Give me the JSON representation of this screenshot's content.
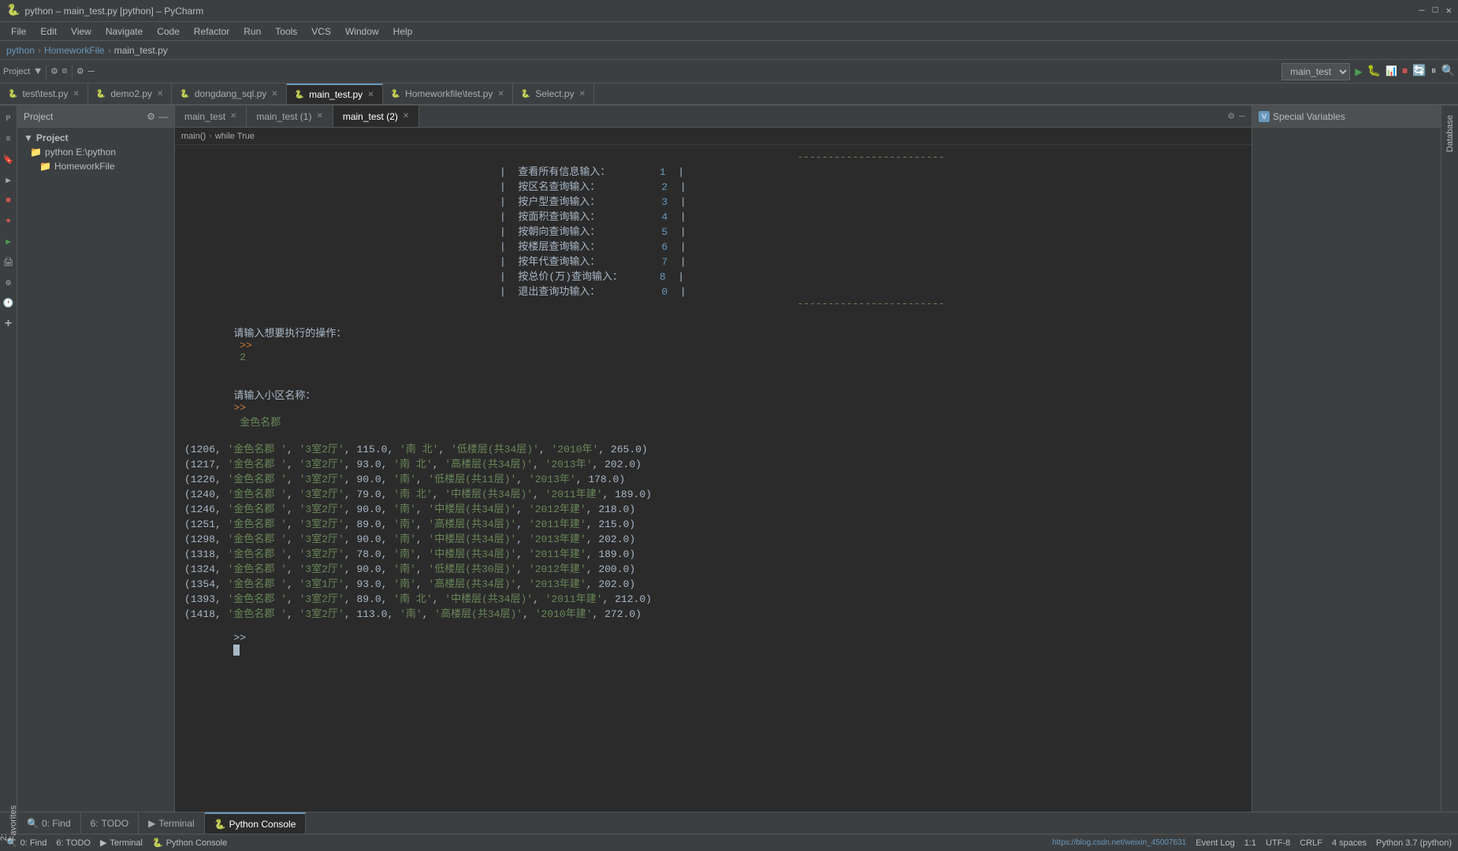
{
  "titlebar": {
    "title": "python – main_test.py [python] – PyCharm",
    "win_min": "—",
    "win_max": "□",
    "win_close": "✕"
  },
  "menubar": {
    "items": [
      "File",
      "Edit",
      "View",
      "Navigate",
      "Code",
      "Refactor",
      "Run",
      "Tools",
      "VCS",
      "Window",
      "Help"
    ]
  },
  "breadcrumb": {
    "parts": [
      "python",
      "HomeworkFile",
      "main_test.py"
    ]
  },
  "run_config": "main_test",
  "file_tabs": [
    {
      "icon": "🐍",
      "label": "test\\test.py",
      "active": false,
      "closable": true
    },
    {
      "icon": "🐍",
      "label": "demo2.py",
      "active": false,
      "closable": true
    },
    {
      "icon": "🐍",
      "label": "dongdang_sql.py",
      "active": false,
      "closable": true
    },
    {
      "icon": "🐍",
      "label": "main_test.py",
      "active": true,
      "closable": true
    },
    {
      "icon": "🐍",
      "label": "Homeworkfile\\test.py",
      "active": false,
      "closable": true
    },
    {
      "icon": "🐍",
      "label": "Select.py",
      "active": false,
      "closable": true
    }
  ],
  "editor_tabs": [
    {
      "label": "main_test",
      "closable": true,
      "active": false
    },
    {
      "label": "main_test (1)",
      "closable": true,
      "active": false
    },
    {
      "label": "main_test (2)",
      "closable": true,
      "active": true
    }
  ],
  "editor_breadcrumb": {
    "parts": [
      "main()",
      "while True"
    ]
  },
  "project_panel": {
    "title": "Project",
    "items": [
      {
        "label": "Project",
        "indent": 0,
        "type": "root"
      },
      {
        "label": "python E:\\python",
        "indent": 1,
        "type": "folder",
        "expanded": true
      },
      {
        "label": "HomeworkFile",
        "indent": 2,
        "type": "folder",
        "expanded": true
      }
    ]
  },
  "console_output": {
    "menu_border": "------------------------",
    "menu_items": [
      {
        "label": "查看所有信息输入：",
        "num": "1"
      },
      {
        "label": "按区名查询输入：",
        "num": "2"
      },
      {
        "label": "按户型查询输入：",
        "num": "3"
      },
      {
        "label": "按面积查询输入：",
        "num": "4"
      },
      {
        "label": "按朝向查询输入：",
        "num": "5"
      },
      {
        "label": "按楼层查询输入：",
        "num": "6"
      },
      {
        "label": "按年代查询输入：",
        "num": "7"
      },
      {
        "label": "按总价(万)查询输入：",
        "num": "8"
      },
      {
        "label": "退出查询功输入：",
        "num": "0"
      }
    ],
    "menu_border2": "------------------------",
    "prompt1": "请输入想要执行的操作：",
    "prompt1_arrow": ">>",
    "prompt1_input": "2",
    "prompt2": "请输入小区名称：",
    "prompt2_arrow": ">>",
    "prompt2_input": "金色名郡",
    "data_rows": [
      "(1206, '金色名郡 ', '3室2厅', 115.0, '南 北', '低楼层(共34层)', '2010年', 265.0)",
      "(1217, '金色名郡 ', '3室2厅', 93.0, '南 北', '高楼层(共34层)', '2013年', 202.0)",
      "(1226, '金色名郡 ', '3室2厅', 90.0, '南', '低楼层(共11层)', '2013年', 178.0)",
      "(1240, '金色名郡 ', '3室2厅', 79.0, '南 北', '中楼层(共34层)', '2011年建', 189.0)",
      "(1246, '金色名郡 ', '3室2厅', 90.0, '南', '中楼层(共34层)', '2012年建', 218.0)",
      "(1251, '金色名郡 ', '3室2厅', 89.0, '南', '高楼层(共34层)', '2011年建', 215.0)",
      "(1298, '金色名郡 ', '3室2厅', 90.0, '南', '中楼层(共34层)', '2013年建', 202.0)",
      "(1318, '金色名郡 ', '3室2厅', 78.0, '南', '中楼层(共34层)', '2011年建', 189.0)",
      "(1324, '金色名郡 ', '3室2厅', 90.0, '南', '低楼层(共30层)', '2012年建', 200.0)",
      "(1354, '金色名郡 ', '3室1厅', 93.0, '南', '高楼层(共34层)', '2013年建', 202.0)",
      "(1393, '金色名郡 ', '3室2厅', 89.0, '南 北', '中楼层(共34层)', '2011年建', 212.0)",
      "(1418, '金色名郡 ', '3室2厅', 113.0, '南', '高楼层(共34层)', '2010年建', 272.0)"
    ],
    "final_prompt": ">> "
  },
  "special_variables": {
    "title": "Special Variables"
  },
  "bottom_tabs": [
    {
      "icon": "🔍",
      "label": "Find",
      "num": "0",
      "active": false
    },
    {
      "icon": "6:",
      "label": "TODO",
      "active": false
    },
    {
      "icon": "▶",
      "label": "Terminal",
      "active": false
    },
    {
      "icon": "🐍",
      "label": "Python Console",
      "active": true
    }
  ],
  "status_bar": {
    "line_col": "1:1",
    "encoding": "UTF-8",
    "line_sep": "CRLF",
    "indent": "4 spaces",
    "python_ver": "Python 3.7 (python)",
    "event_log": "Event Log",
    "url": "https://blog.csdn.net/weixin_45007631"
  },
  "colors": {
    "accent_blue": "#6897bb",
    "accent_green": "#499c54",
    "accent_orange": "#cc7832",
    "string_green": "#6a8759",
    "bg_dark": "#2b2b2b",
    "bg_mid": "#3c3f41",
    "bg_light": "#4c5052",
    "text_main": "#a9b7c6",
    "border": "#555555"
  }
}
